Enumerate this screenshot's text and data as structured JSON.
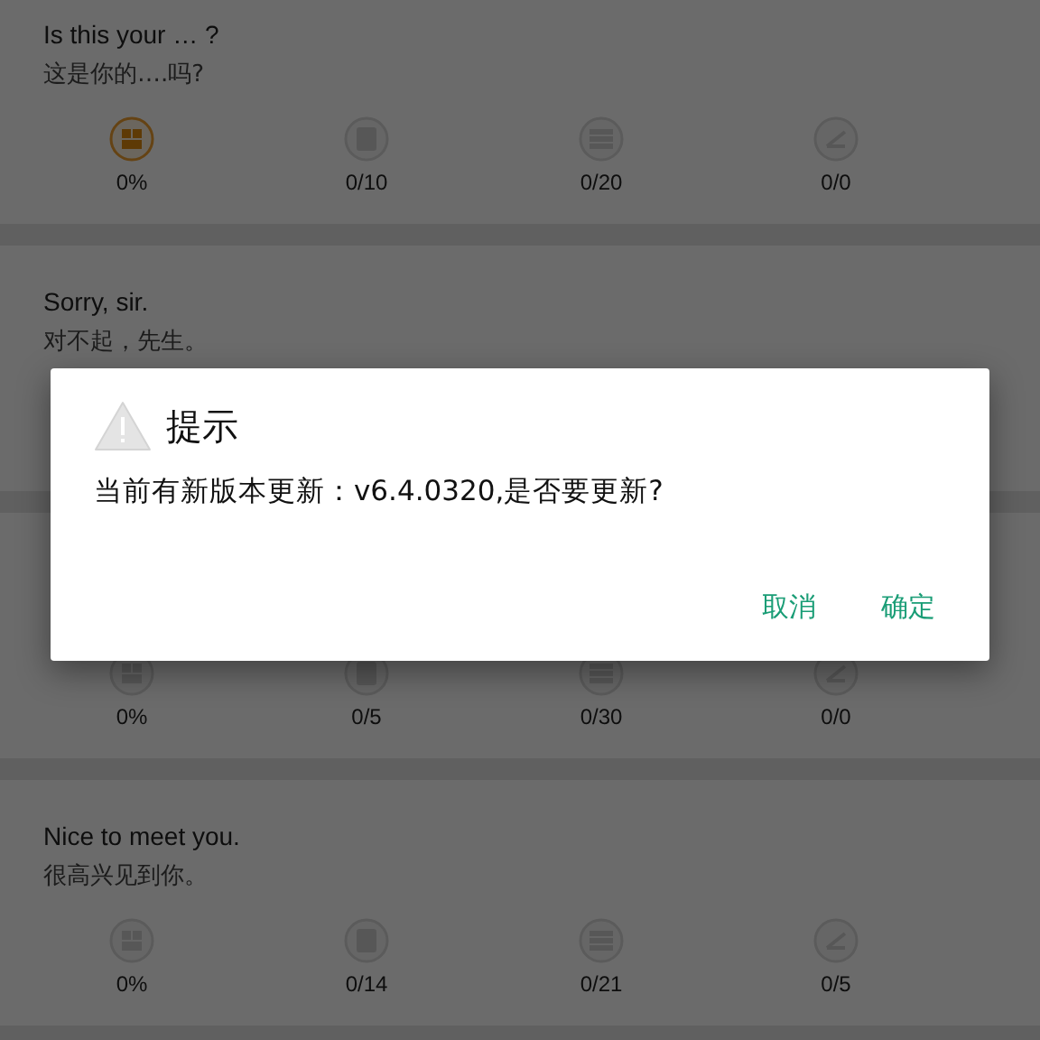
{
  "lessons": [
    {
      "english": "Is this your … ?",
      "chinese": "这是你的….吗?",
      "stats": [
        {
          "kind": "progress",
          "active": true,
          "value": "0%"
        },
        {
          "kind": "words",
          "active": false,
          "value": "0/10"
        },
        {
          "kind": "sentences",
          "active": false,
          "value": "0/20"
        },
        {
          "kind": "speaking",
          "active": false,
          "value": "0/0"
        }
      ]
    },
    {
      "english": "Sorry, sir.",
      "chinese": "对不起，先生。"
    },
    {
      "stats": [
        {
          "kind": "progress",
          "active": false,
          "value": "0%"
        },
        {
          "kind": "words",
          "active": false,
          "value": "0/5"
        },
        {
          "kind": "sentences",
          "active": false,
          "value": "0/30"
        },
        {
          "kind": "speaking",
          "active": false,
          "value": "0/0"
        }
      ]
    },
    {
      "english": "Nice to meet you.",
      "chinese": "很高兴见到你。",
      "stats": [
        {
          "kind": "progress",
          "active": false,
          "value": "0%"
        },
        {
          "kind": "words",
          "active": false,
          "value": "0/14"
        },
        {
          "kind": "sentences",
          "active": false,
          "value": "0/21"
        },
        {
          "kind": "speaking",
          "active": false,
          "value": "0/5"
        }
      ]
    }
  ],
  "dialog": {
    "title": "提示",
    "message": "当前有新版本更新：v6.4.0320,是否要更新?",
    "buttons": [
      "取消",
      "确定"
    ]
  }
}
